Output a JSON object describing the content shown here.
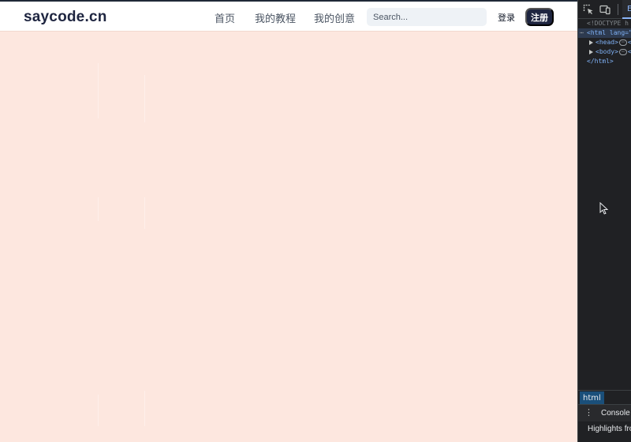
{
  "navbar": {
    "brand": "saycode.cn",
    "links": [
      "首页",
      "我的教程",
      "我的创意"
    ],
    "search_placeholder": "Search...",
    "login_label": "登录",
    "register_label": "注册"
  },
  "devtools": {
    "active_tab": "E",
    "dom_lines": {
      "doctype": "<!DOCTYPE h",
      "html_open": "<html lang=\"",
      "head": "<head>",
      "body": "<body>",
      "html_close": "</html>"
    },
    "breadcrumb": "html",
    "drawer_tab": "Console",
    "drawer_text": "Highlights fro"
  },
  "colors": {
    "page_background": "#fde7df",
    "brand_navy": "#1e2540",
    "devtools_background": "#202124",
    "breadcrumb_highlight": "#1a4f7a"
  },
  "icons": [
    "inspect-element-icon",
    "device-toolbar-icon",
    "expand-triangle-icon",
    "kebab-menu-icon",
    "mouse-cursor-icon"
  ]
}
